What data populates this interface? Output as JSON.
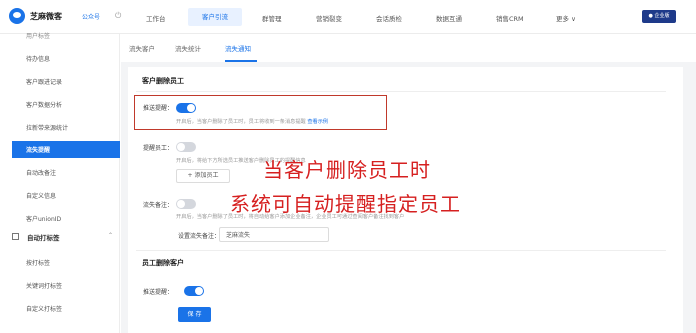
{
  "topbar": {
    "brand": "芝麻微客",
    "account": "公众号",
    "nav": [
      "工作台",
      "客户引流",
      "群管理",
      "营销裂变",
      "会话质检",
      "数据互通",
      "销售CRM",
      "更多 ∨"
    ],
    "active_nav": "客户引流",
    "edition_badge": "● 企业版"
  },
  "sidebar": {
    "items": [
      "用户标签",
      "待办信息",
      "客户跟进记录",
      "客户数据分析",
      "拉新带来源统计"
    ],
    "active": "流失提醒",
    "items_after": [
      "自动改备注",
      "自定义信息",
      "客户unionID"
    ],
    "group": "自动打标签",
    "group_items": [
      "按打标签",
      "关键词打标签",
      "自定义打标签"
    ]
  },
  "subtabs": [
    "流失客户",
    "流失统计",
    "流失通知"
  ],
  "active_subtab": "流失通知",
  "sections": {
    "delete_staff_title": "客户删除员工",
    "push_label": "推送提醒：",
    "push_hint": "开启后，当客户删除了员工时，员工将收到一条消息提醒",
    "push_hint_link": "查看示例",
    "notify_label": "提醒员工：",
    "notify_hint": "开启后，将给下方所选员工推送客户删除员工的提醒信息",
    "add_staff": "+ 添加员工",
    "remark_label": "流失备注：",
    "remark_hint": "开启后，当客户删除了员工时，将自动给客户添加企业备注，企业员工可通过查阅客户备注找到客户",
    "remark_setting_label": "设置流失备注：",
    "remark_value": "芝麻流失",
    "staff_delete_title": "员工删除客户",
    "push_label_2": "推送提醒：",
    "save": "保 存"
  },
  "overlay": {
    "line1": "当客户删除员工时",
    "line2": "系统可自动提醒指定员工"
  },
  "colors": {
    "accent": "#1a73e8",
    "overlay_red": "#d62020",
    "highlight_border": "#c0392b"
  }
}
